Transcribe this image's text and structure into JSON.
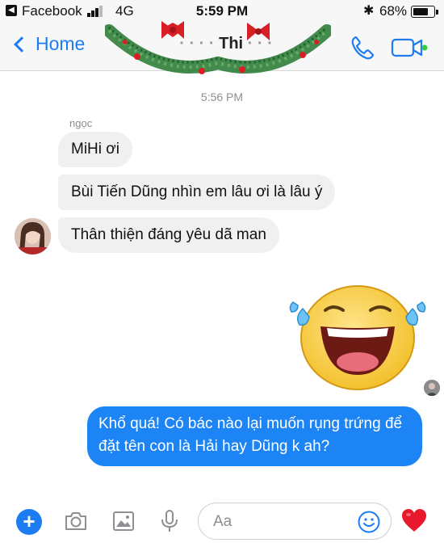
{
  "status_bar": {
    "back_app": "Facebook",
    "network": "4G",
    "time": "5:59 PM",
    "battery": "68%"
  },
  "nav": {
    "back_label": "Home",
    "title_fragments": [
      "Thi"
    ]
  },
  "conversation": {
    "timestamp": "5:56 PM",
    "sender_name": "ngọc",
    "incoming": [
      "MiHi ơi",
      "Bùi Tiến Dũng nhìn em lâu ơi là lâu ý",
      "Thân thiện đáng yêu dã man"
    ],
    "outgoing": "Khổ quá! Có bác nào lại muốn rụng trứng để đặt tên con là Hải hay Dũng k ah?"
  },
  "composer": {
    "placeholder": "Aa"
  },
  "colors": {
    "accent": "#1d7cf2",
    "outgoing_bubble": "#1d84f5",
    "incoming_bubble": "#f0f0f0",
    "heart": "#e8192c"
  },
  "icons": [
    "back-chevron-icon",
    "phone-icon",
    "video-call-icon",
    "plus-icon",
    "camera-icon",
    "gallery-icon",
    "microphone-icon",
    "emoji-icon",
    "heart-icon"
  ]
}
